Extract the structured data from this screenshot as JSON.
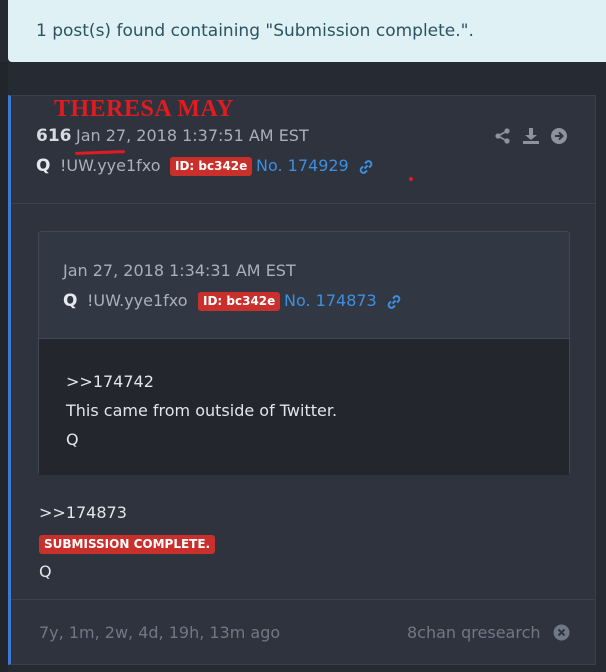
{
  "banner": {
    "text": "1 post(s) found containing \"Submission complete.\"."
  },
  "overlay": {
    "name": "THERESA MAY"
  },
  "post": {
    "number": "616",
    "date": "Jan 27, 2018 1:37:51 AM EST",
    "author": "Q",
    "tripcode": "!UW.yye1fxo",
    "id_badge": "ID: bc342e",
    "post_no": "No. 174929",
    "quote": {
      "date": "Jan 27, 2018 1:34:31 AM EST",
      "author": "Q",
      "tripcode": "!UW.yye1fxo",
      "id_badge": "ID: bc342e",
      "post_no": "No. 174873",
      "lines": [
        ">>174742",
        "This came from outside of Twitter.",
        "Q"
      ]
    },
    "reply_ref": ">>174873",
    "submission_badge": "SUBMISSION COMPLETE.",
    "signature": "Q",
    "age": "7y, 1m, 2w, 4d, 19h, 13m ago",
    "source": "8chan qresearch"
  },
  "colors": {
    "accent": "#3b7bd4",
    "badge": "#c9302c",
    "overlay_red": "#e01b22",
    "link": "#3d8fe0"
  }
}
